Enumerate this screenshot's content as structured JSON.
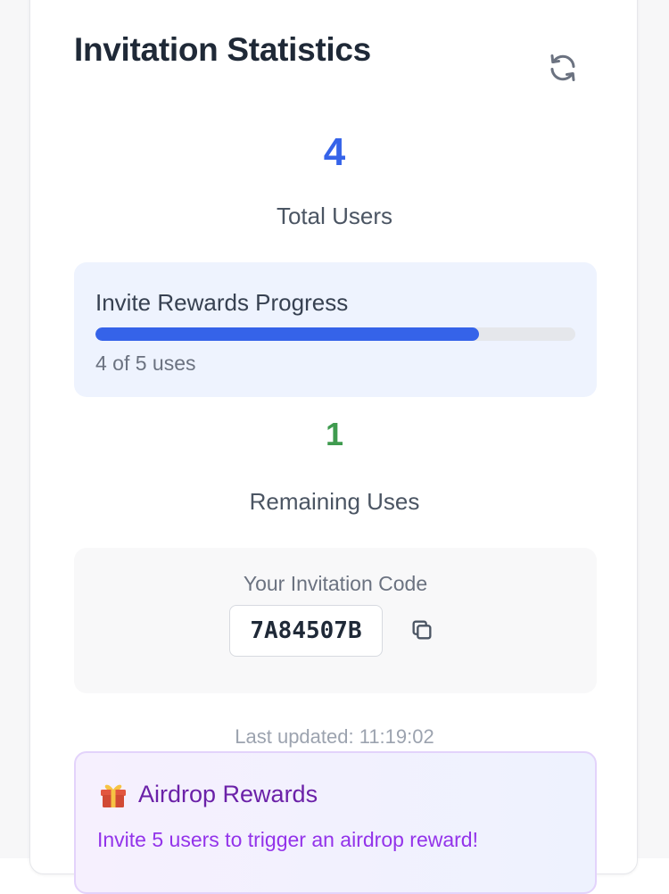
{
  "header": {
    "title": "Invitation Statistics",
    "refresh_icon": "refresh-icon"
  },
  "stats": {
    "total_users_value": "4",
    "total_users_label": "Total Users",
    "remaining_value": "1",
    "remaining_label": "Remaining Uses"
  },
  "progress": {
    "title": "Invite Rewards Progress",
    "used": 4,
    "total": 5,
    "fraction": 0.8,
    "summary": "4 of 5 uses"
  },
  "invite_code": {
    "title": "Your Invitation Code",
    "code": "7A84507B",
    "copy_icon": "copy-icon"
  },
  "last_updated": "Last updated: 11:19:02",
  "airdrop": {
    "title": "Airdrop Rewards",
    "icon": "gift-icon",
    "text": "Invite 5 users to trigger an airdrop reward!"
  },
  "colors": {
    "accent_blue": "#3563e9",
    "success_green": "#3f9b4f",
    "purple": "#6b21a8",
    "purple_light": "#9333ea"
  }
}
